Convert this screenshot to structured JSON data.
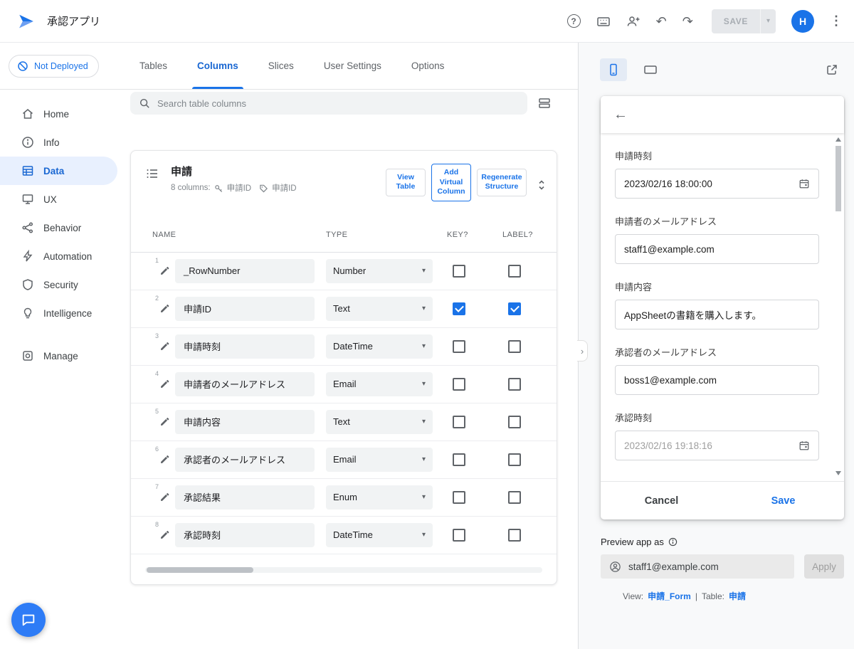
{
  "topbar": {
    "app_title": "承認アプリ",
    "save_label": "SAVE",
    "avatar_initial": "H"
  },
  "deploy_badge": "Not Deployed",
  "sidebar": [
    {
      "label": "Home",
      "icon": "home-icon",
      "active": false
    },
    {
      "label": "Info",
      "icon": "info-icon",
      "active": false
    },
    {
      "label": "Data",
      "icon": "data-icon",
      "active": true
    },
    {
      "label": "UX",
      "icon": "ux-icon",
      "active": false
    },
    {
      "label": "Behavior",
      "icon": "behavior-icon",
      "active": false
    },
    {
      "label": "Automation",
      "icon": "automation-icon",
      "active": false
    },
    {
      "label": "Security",
      "icon": "security-icon",
      "active": false
    },
    {
      "label": "Intelligence",
      "icon": "intelligence-icon",
      "active": false
    },
    {
      "label": "Manage",
      "icon": "manage-icon",
      "active": false
    }
  ],
  "nav_tabs": [
    {
      "label": "Tables",
      "active": false
    },
    {
      "label": "Columns",
      "active": true
    },
    {
      "label": "Slices",
      "active": false
    },
    {
      "label": "User Settings",
      "active": false
    },
    {
      "label": "Options",
      "active": false
    }
  ],
  "search_placeholder": "Search table columns",
  "table_card": {
    "title": "申請",
    "columns_count": "8 columns:",
    "key_name": "申請ID",
    "label_name": "申請ID",
    "view_table_label": "View Table",
    "add_virtual_label": "Add Virtual Column",
    "regenerate_label": "Regenerate Structure",
    "headers": {
      "name": "NAME",
      "type": "TYPE",
      "key": "KEY?",
      "label": "LABEL?"
    },
    "rows": [
      {
        "num": "1",
        "name": "_RowNumber",
        "type": "Number",
        "key": false,
        "label": false
      },
      {
        "num": "2",
        "name": "申請ID",
        "type": "Text",
        "key": true,
        "label": true
      },
      {
        "num": "3",
        "name": "申請時刻",
        "type": "DateTime",
        "key": false,
        "label": false
      },
      {
        "num": "4",
        "name": "申請者のメールアドレス",
        "type": "Email",
        "key": false,
        "label": false
      },
      {
        "num": "5",
        "name": "申請内容",
        "type": "Text",
        "key": false,
        "label": false
      },
      {
        "num": "6",
        "name": "承認者のメールアドレス",
        "type": "Email",
        "key": false,
        "label": false
      },
      {
        "num": "7",
        "name": "承認結果",
        "type": "Enum",
        "key": false,
        "label": false
      },
      {
        "num": "8",
        "name": "承認時刻",
        "type": "DateTime",
        "key": false,
        "label": false
      }
    ]
  },
  "preview_panel": {
    "form": {
      "fields": [
        {
          "label": "申請時刻",
          "value": "2023/02/16 18:00:00",
          "calendar": true,
          "muted": false
        },
        {
          "label": "申請者のメールアドレス",
          "value": "staff1@example.com",
          "calendar": false,
          "muted": false
        },
        {
          "label": "申請内容",
          "value": "AppSheetの書籍を購入します。",
          "calendar": false,
          "muted": false
        },
        {
          "label": "承認者のメールアドレス",
          "value": "boss1@example.com",
          "calendar": false,
          "muted": false
        },
        {
          "label": "承認時刻",
          "value": "2023/02/16 19:18:16",
          "calendar": true,
          "muted": true
        }
      ],
      "cancel_label": "Cancel",
      "save_label": "Save"
    },
    "preview_as_label": "Preview app as",
    "preview_user": "staff1@example.com",
    "apply_label": "Apply",
    "footer": {
      "view_label": "View:",
      "view_link": "申請_Form",
      "separator": "|",
      "table_label": "Table:",
      "table_link": "申請"
    }
  },
  "colors": {
    "accent": "#1a73e8",
    "active_tab": "#1967d2",
    "active_nav_bg": "#e8f0fe",
    "checked_checkbox": "#1a73e8",
    "field_bg": "#f1f3f4"
  }
}
